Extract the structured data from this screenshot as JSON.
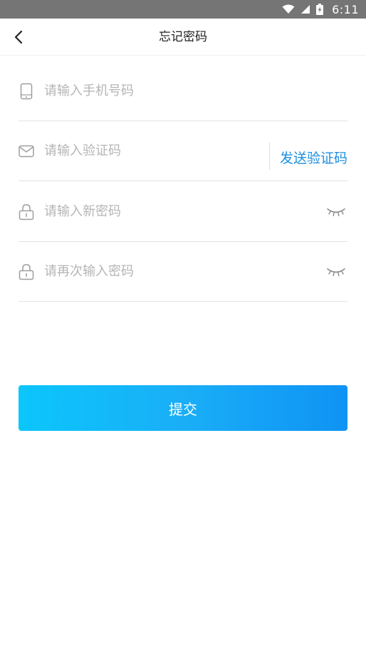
{
  "status_bar": {
    "time": "6:11",
    "icons": [
      "wifi-icon",
      "cell-signal-icon",
      "battery-charging-icon"
    ]
  },
  "nav": {
    "title": "忘记密码",
    "back_icon": "chevron-left-icon"
  },
  "form": {
    "phone": {
      "placeholder": "请输入手机号码",
      "icon": "phone-icon",
      "value": ""
    },
    "code": {
      "placeholder": "请输入验证码",
      "icon": "mail-icon",
      "value": "",
      "send_label": "发送验证码"
    },
    "new_password": {
      "placeholder": "请输入新密码",
      "icon": "lock-icon",
      "toggle_icon": "eye-closed-icon",
      "value": ""
    },
    "confirm_password": {
      "placeholder": "请再次输入密码",
      "icon": "lock-icon",
      "toggle_icon": "eye-closed-icon",
      "value": ""
    }
  },
  "submit": {
    "label": "提交"
  },
  "colors": {
    "accent": "#1d8fe0",
    "button_gradient_start": "#0bc6fb",
    "button_gradient_end": "#0f93f4",
    "status_bar": "#757575"
  }
}
